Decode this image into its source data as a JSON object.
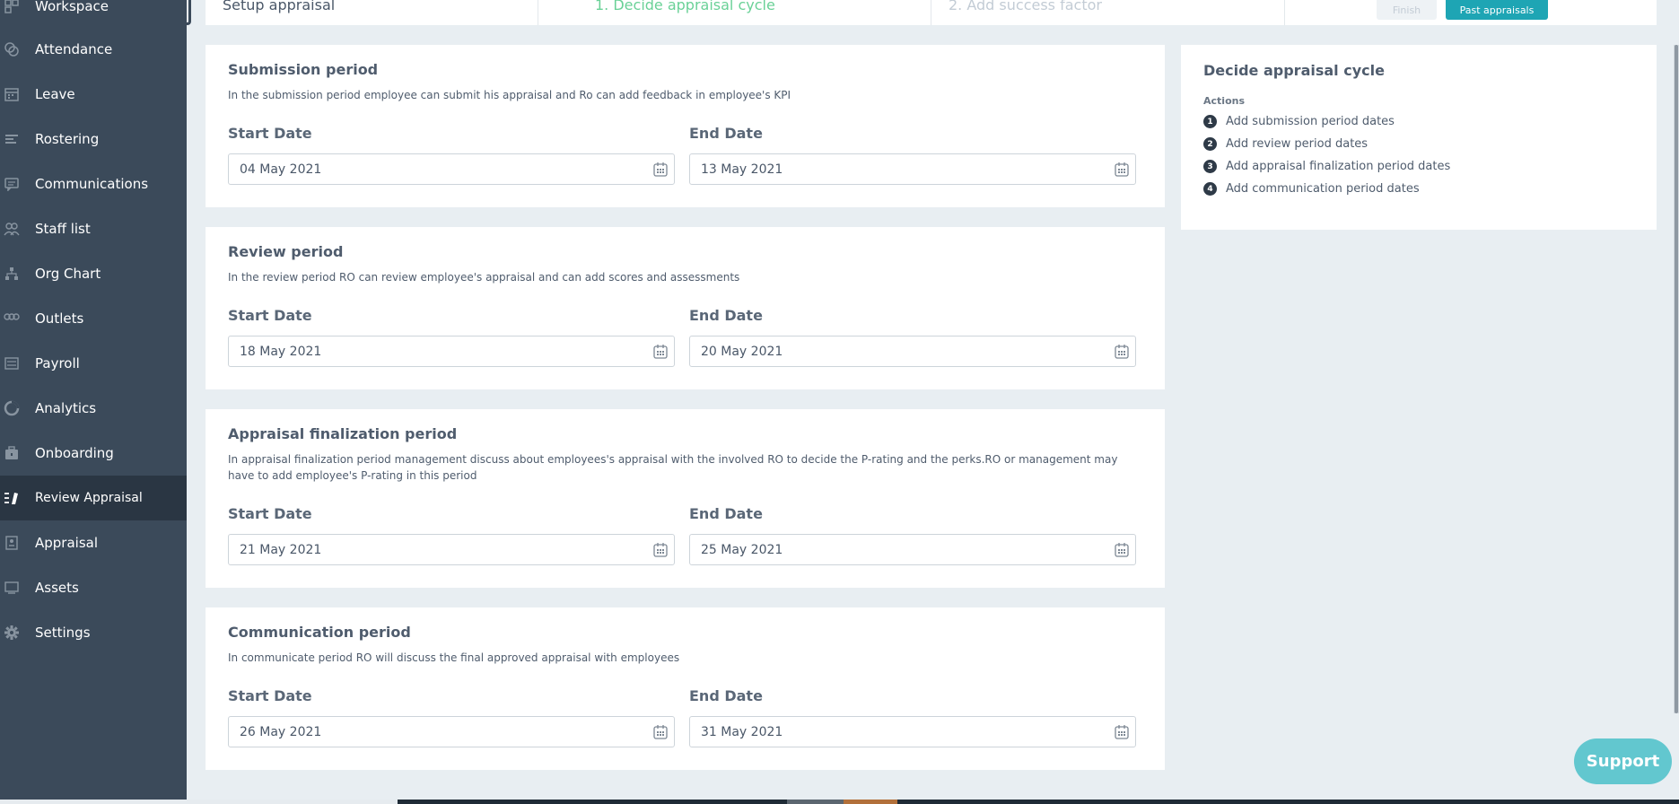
{
  "sidebar": {
    "items": [
      {
        "label": "Workspace",
        "icon": "workspace-icon",
        "active": false
      },
      {
        "label": "Attendance",
        "icon": "attendance-icon",
        "active": false
      },
      {
        "label": "Leave",
        "icon": "calendar-icon",
        "active": false
      },
      {
        "label": "Rostering",
        "icon": "rostering-icon",
        "active": false
      },
      {
        "label": "Communications",
        "icon": "chat-icon",
        "active": false
      },
      {
        "label": "Staff list",
        "icon": "people-icon",
        "active": false
      },
      {
        "label": "Org Chart",
        "icon": "org-chart-icon",
        "active": false
      },
      {
        "label": "Outlets",
        "icon": "outlets-icon",
        "active": false
      },
      {
        "label": "Payroll",
        "icon": "payroll-icon",
        "active": false
      },
      {
        "label": "Analytics",
        "icon": "analytics-icon",
        "active": false
      },
      {
        "label": "Onboarding",
        "icon": "briefcase-icon",
        "active": false
      },
      {
        "label": "Review Appraisal",
        "icon": "review-icon",
        "active": true
      },
      {
        "label": "Appraisal",
        "icon": "appraisal-icon",
        "active": false
      },
      {
        "label": "Assets",
        "icon": "assets-icon",
        "active": false
      },
      {
        "label": "Settings",
        "icon": "gear-icon",
        "active": false
      }
    ]
  },
  "topbar": {
    "title": "Setup appraisal",
    "step1": "1. Decide appraisal cycle",
    "step2": "2. Add success factor",
    "finish_label": "Finish",
    "past_label": "Past appraisals"
  },
  "periods": [
    {
      "title": "Submission period",
      "description": "In the submission period employee can submit his appraisal and Ro can add feedback in employee's KPI",
      "start_label": "Start Date",
      "end_label": "End Date",
      "start_value": "04 May 2021",
      "end_value": "13 May 2021"
    },
    {
      "title": "Review period",
      "description": "In the review period RO can review employee's appraisal and can add scores and assessments",
      "start_label": "Start Date",
      "end_label": "End Date",
      "start_value": "18 May 2021",
      "end_value": "20 May 2021"
    },
    {
      "title": "Appraisal finalization period",
      "description": "In appraisal finalization period management discuss about employees's appraisal with the involved RO to decide the P-rating and the perks.RO or management may have to add employee's P-rating in this period",
      "start_label": "Start Date",
      "end_label": "End Date",
      "start_value": "21 May 2021",
      "end_value": "25 May 2021"
    },
    {
      "title": "Communication period",
      "description": "In communicate period RO will discuss the final approved appraisal with employees",
      "start_label": "Start Date",
      "end_label": "End Date",
      "start_value": "26 May 2021",
      "end_value": "31 May 2021"
    }
  ],
  "actions_panel": {
    "title": "Decide appraisal cycle",
    "subtitle": "Actions",
    "items": [
      {
        "num": "1",
        "label": "Add submission period dates"
      },
      {
        "num": "2",
        "label": "Add review period dates"
      },
      {
        "num": "3",
        "label": "Add appraisal finalization period dates"
      },
      {
        "num": "4",
        "label": "Add communication period dates"
      }
    ]
  },
  "support": {
    "label": "Support"
  },
  "colors": {
    "sidebar_bg": "#3b4a5a",
    "sidebar_active": "#2a3643",
    "accent_teal": "#1ea5b4",
    "step_active_green": "#6ad197",
    "page_bg": "#e8eef2",
    "support_bg": "#62c7cf"
  }
}
